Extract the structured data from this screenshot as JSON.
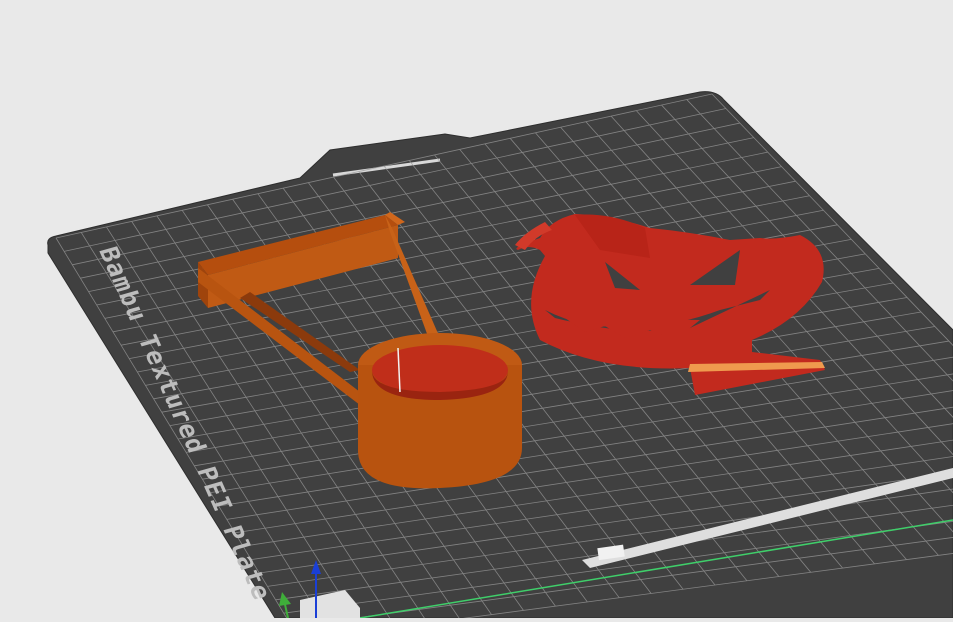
{
  "scene": {
    "plate_name": "Bambu Textured PEI Plate",
    "badge_text": "",
    "corner_text": "",
    "colors": {
      "background": "#e9e9e9",
      "plate": "#404040",
      "grid": "#9a9a9a",
      "model_handle": "#c05a14",
      "model_pumpkin": "#c22a1e",
      "axis_x": "#e03c2c",
      "axis_y": "#3fae3a",
      "axis_z": "#1a3fd6",
      "bed_edge": "#3fcf6a"
    },
    "objects": [
      {
        "name": "handle-model",
        "color": "#c05a14"
      },
      {
        "name": "pumpkin-model",
        "color": "#c22a1e"
      }
    ]
  }
}
